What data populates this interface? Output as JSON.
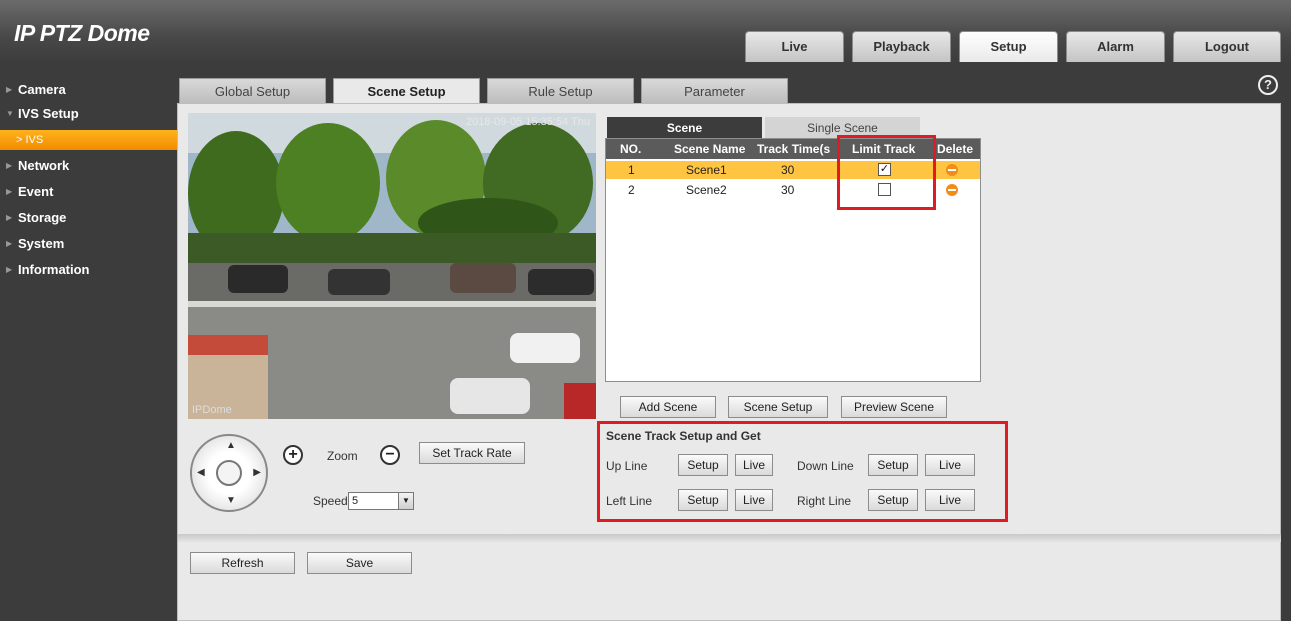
{
  "app": {
    "title": "IP PTZ Dome"
  },
  "nav": {
    "items": [
      {
        "label": "Live",
        "active": false
      },
      {
        "label": "Playback",
        "active": false
      },
      {
        "label": "Setup",
        "active": true
      },
      {
        "label": "Alarm",
        "active": false
      },
      {
        "label": "Logout",
        "active": false
      }
    ]
  },
  "sidebar": {
    "items": [
      {
        "label": "Camera"
      },
      {
        "label": "IVS Setup",
        "expanded": true,
        "sub": "IVS"
      },
      {
        "label": "Network"
      },
      {
        "label": "Event"
      },
      {
        "label": "Storage"
      },
      {
        "label": "System"
      },
      {
        "label": "Information"
      }
    ]
  },
  "tabs": [
    {
      "label": "Global Setup"
    },
    {
      "label": "Scene Setup",
      "active": true
    },
    {
      "label": "Rule Setup"
    },
    {
      "label": "Parameter"
    }
  ],
  "help_icon": "question-circle-icon",
  "video": {
    "timestamp": "2018-09-05 15:35:54 Thu",
    "osd": "IPDome"
  },
  "ptz": {
    "zoom_label": "Zoom",
    "zoom_in": "+",
    "zoom_out": "−",
    "set_track_rate": "Set Track Rate",
    "speed_label": "Speed",
    "speed_value": "5"
  },
  "scene_tabs": {
    "scene": "Scene",
    "single": "Single Scene"
  },
  "scene_table": {
    "headers": {
      "no": "NO.",
      "name": "Scene Name",
      "time": "Track Time(s",
      "limit": "Limit Track",
      "delete": "Delete"
    },
    "rows": [
      {
        "no": "1",
        "name": "Scene1",
        "time": "30",
        "limit_checked": true,
        "check_glyph": "✓"
      },
      {
        "no": "2",
        "name": "Scene2",
        "time": "30",
        "limit_checked": false,
        "check_glyph": ""
      }
    ]
  },
  "scene_buttons": {
    "add": "Add Scene",
    "setup": "Scene Setup",
    "preview": "Preview Scene"
  },
  "track": {
    "title": "Scene Track Setup and Get",
    "up": "Up Line",
    "down": "Down Line",
    "left": "Left Line",
    "right": "Right Line",
    "setup": "Setup",
    "live": "Live"
  },
  "footer": {
    "refresh": "Refresh",
    "save": "Save"
  },
  "colors": {
    "accent": "#f29100",
    "highlight_box": "#e11b22",
    "selected_row": "#ffc441"
  }
}
